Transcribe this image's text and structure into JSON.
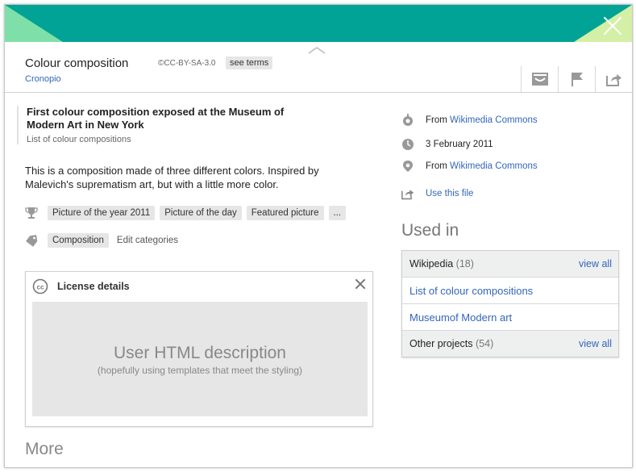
{
  "header": {
    "title": "Colour composition",
    "license": "CC-BY-SA-3.0",
    "see_terms": "see terms",
    "author": "Cronopio"
  },
  "description": {
    "title": "First colour composition exposed at the Museum of Modern Art in New York",
    "subtitle": "List of colour compositions",
    "text": "This is a composition made of three different colors. Inspired by Malevich's suprematism art, but with a little more color."
  },
  "awards": [
    "Picture of the year 2011",
    "Picture of the day",
    "Featured picture",
    "..."
  ],
  "categories": {
    "items": [
      "Composition"
    ],
    "edit_label": "Edit categories"
  },
  "license_box": {
    "title": "License details",
    "placeholder_main": "User HTML description",
    "placeholder_sub": "(hopefully using templates that meet the styling)"
  },
  "more_label": "More",
  "meta": {
    "source_prefix": "From",
    "source_link": "Wikimedia Commons",
    "date": "3 February 2011",
    "location_prefix": "From",
    "location_link": "Wikimedia Commons",
    "use_file": "Use this file"
  },
  "used_in": {
    "heading": "Used in",
    "wikipedia_label": "Wikipedia",
    "wikipedia_count": "(18)",
    "view_all": "view all",
    "links": [
      "List of colour compositions",
      "Museumof Modern art"
    ],
    "other_label": "Other projects",
    "other_count": "(54)"
  },
  "colors": {
    "banner": "#00a396",
    "link": "#3366bb"
  }
}
